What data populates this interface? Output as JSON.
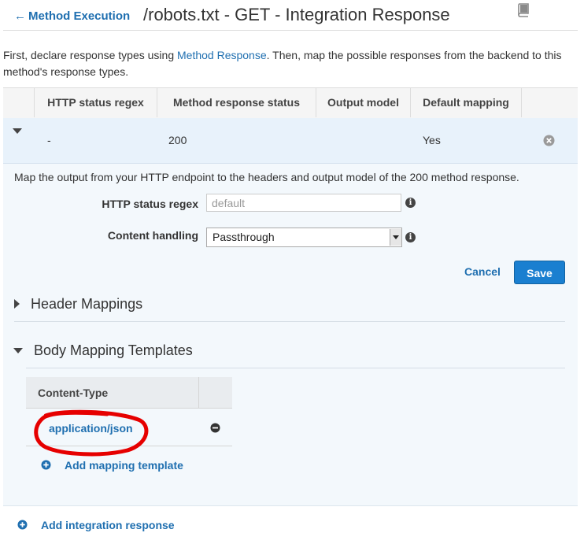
{
  "header": {
    "back_label": "Method Execution",
    "title": "/robots.txt - GET - Integration Response",
    "docs_icon": "book-icon"
  },
  "intro": {
    "before_link": "First, declare response types using ",
    "link": "Method Response",
    "after_link": ". Then, map the possible responses from the backend to this method's response types."
  },
  "table": {
    "columns": [
      "HTTP status regex",
      "Method response status",
      "Output model",
      "Default mapping"
    ],
    "rows": [
      {
        "regex": "-",
        "status": "200",
        "model": "",
        "default": "Yes"
      }
    ]
  },
  "panel": {
    "description": "Map the output from your HTTP endpoint to the headers and output model of the 200 method response.",
    "regex_label": "HTTP status regex",
    "regex_placeholder": "default",
    "content_label": "Content handling",
    "content_value": "Passthrough",
    "cancel_label": "Cancel",
    "save_label": "Save"
  },
  "sections": {
    "header_mappings": "Header Mappings",
    "body_mapping_templates": "Body Mapping Templates"
  },
  "content_types": {
    "header": "Content-Type",
    "items": [
      "application/json"
    ],
    "add_label": "Add mapping template"
  },
  "add_integration_label": "Add integration response",
  "colors": {
    "accent": "#1f6fb0",
    "save_button": "#1a7fd0",
    "row_highlight": "#e8f2fb",
    "annotation": "#e60000"
  }
}
